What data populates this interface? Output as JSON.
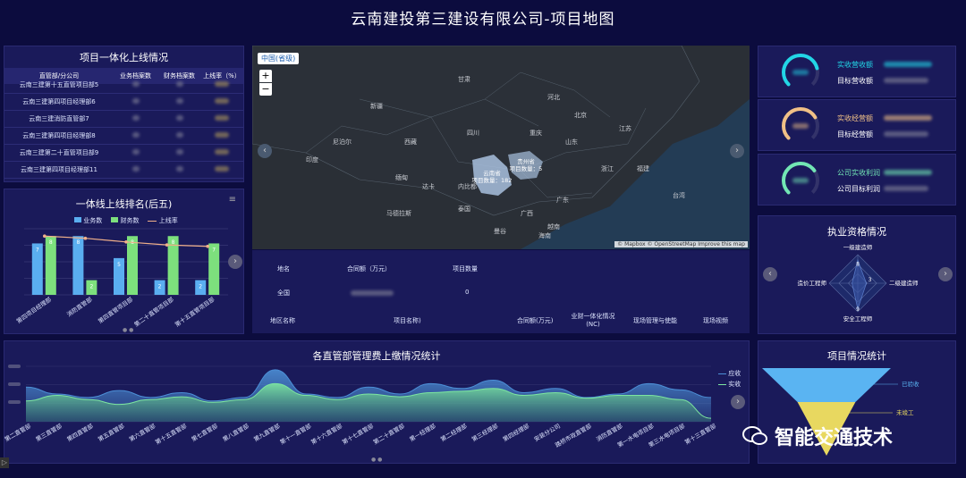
{
  "page_title": "云南建投第三建设有限公司-项目地图",
  "table_panel": {
    "title": "项目一体化上线情况",
    "headers": [
      "直管部/分公司",
      "业务档案数",
      "财务档案数",
      "上线率（%）"
    ],
    "rows": [
      {
        "name": "云南三建第十五直管项目部5"
      },
      {
        "name": "云南三建第四项目经理部6"
      },
      {
        "name": "云南三建消防直管部7"
      },
      {
        "name": "云南三建第四项目经理部8"
      },
      {
        "name": "云南三建第二十直管项目部9"
      },
      {
        "name": "云南三建第四项目经理部11"
      }
    ]
  },
  "ranking_panel": {
    "title": "一体线上线排名(后五)",
    "menu_icon": "menu-icon",
    "legend": [
      "业务数",
      "财务数",
      "上线率"
    ],
    "colors": {
      "business": "#5aaef0",
      "finance": "#7de07d",
      "rate": "#f0b08a"
    },
    "chart_data": {
      "type": "bar",
      "categories": [
        "第四项目经理部",
        "消防直管部",
        "第四直管项目部",
        "第二十直管项目部",
        "第十五直管项目部"
      ],
      "series": [
        {
          "name": "业务数",
          "values": [
            7,
            8,
            5,
            2,
            2
          ]
        },
        {
          "name": "财务数",
          "values": [
            8,
            2,
            8,
            8,
            7
          ]
        },
        {
          "name": "上线率",
          "values": [
            8,
            7.7,
            7.2,
            6.8,
            6.6
          ]
        }
      ],
      "bar_labels": [
        "7",
        "2",
        "5",
        "2",
        "2",
        "2"
      ],
      "ylim": [
        0,
        9
      ]
    }
  },
  "map_panel": {
    "layer_label": "中国(省级)",
    "zoom_in": "+",
    "zoom_out": "−",
    "highlight_region_1": {
      "name": "云南省",
      "count_text": "项目数量：182"
    },
    "highlight_region_2": {
      "name": "贵州省",
      "count_text": "项目数量：5"
    },
    "place_labels": [
      "新疆",
      "甘肃",
      "宁夏",
      "山西",
      "河北",
      "北京",
      "天津",
      "山东",
      "河南",
      "陕西",
      "青海",
      "西藏",
      "四川",
      "重庆",
      "湖北",
      "安徽",
      "江苏",
      "上海",
      "浙江",
      "江西",
      "湖南",
      "福建",
      "台湾",
      "广东",
      "广西",
      "海南",
      "尼泊尔",
      "印度",
      "孟加拉国",
      "缅甸",
      "老挝",
      "泰国",
      "越南",
      "马德拉斯",
      "加尔各答",
      "达卡",
      "内比都",
      "仰光",
      "河内",
      "曼谷",
      "万象",
      "锡金",
      "不丹"
    ],
    "attribution": "© Mapbox © OpenStreetMap Improve this map"
  },
  "map_table": {
    "summary_headers": [
      "地名",
      "合同额（万元）",
      "项目数量"
    ],
    "summary_row": {
      "place": "全国",
      "count": "0"
    },
    "detail_headers": [
      "地区名称",
      "项目名称)",
      "合同额(万元)",
      "业财一体化情况 (NC)",
      "现场管理与使能",
      "现场视频"
    ]
  },
  "kpis": [
    {
      "label1": "实收营收额",
      "label2": "目标营收额",
      "color": "#22d6e6",
      "percent": 0.78
    },
    {
      "label1": "实收经营额",
      "label2": "目标经营额",
      "color": "#f0c086",
      "percent": 0.72
    },
    {
      "label1": "公司实收利润",
      "label2": "公司目标利润",
      "color": "#72e6b4",
      "percent": 0.7
    }
  ],
  "qualification_panel": {
    "title": "执业资格情况",
    "chart_data": {
      "type": "radar",
      "axes": [
        "一级建造师",
        "二级建造师",
        "安全工程师",
        "造价工程师"
      ],
      "values": [
        8,
        3,
        9,
        2
      ]
    },
    "value_labels": [
      "8",
      "3",
      "9"
    ]
  },
  "fee_panel": {
    "title": "各直管部管理费上缴情况统计",
    "legend": [
      "应收",
      "实收"
    ],
    "colors": {
      "receivable": "#4c8fd6",
      "received": "#7de6a0"
    },
    "chart_data": {
      "type": "area",
      "categories": [
        "第二直管部",
        "第三直管部",
        "第四直管部",
        "第五直管部",
        "第六直管部",
        "第十五直管部",
        "第七直管部",
        "第八直管部",
        "第九直管部",
        "第十一直管部",
        "第十六直管部",
        "第十七直管部",
        "第二十直管部",
        "第一经理部",
        "第二经理部",
        "第三经理部",
        "第四经理部",
        "安装分公司",
        "路桥市政直管部",
        "消防直管部",
        "第一水电项目部",
        "第三水电项目部",
        "第十三直管部"
      ],
      "series": [
        {
          "name": "应收",
          "values": [
            5,
            4,
            3.5,
            4.5,
            3.5,
            4.2,
            3,
            3.5,
            7.5,
            4,
            3.5,
            5,
            4,
            5.5,
            4.8,
            6,
            4.2,
            4.8,
            3.5,
            4,
            5.5,
            4.6,
            3.5
          ]
        },
        {
          "name": "实收",
          "values": [
            3,
            3.8,
            3.2,
            2.5,
            3.2,
            3.6,
            2.8,
            3.2,
            5.5,
            3.8,
            3.2,
            4,
            3.6,
            4.2,
            4.4,
            4.8,
            3.8,
            4.2,
            3.4,
            3.8,
            3.8,
            3.2,
            0.5
          ]
        }
      ],
      "ylim": [
        0,
        8
      ]
    }
  },
  "project_panel": {
    "title": "项目情况统计",
    "chart_data": {
      "type": "funnel",
      "categories": [
        "已验收",
        "未竣工"
      ],
      "values": [
        100,
        45
      ]
    },
    "colors": {
      "top": "#5ab4f2",
      "bottom": "#e8d860"
    }
  },
  "watermark": {
    "text": "智能交通技术"
  },
  "bottom_toggle": "▷"
}
